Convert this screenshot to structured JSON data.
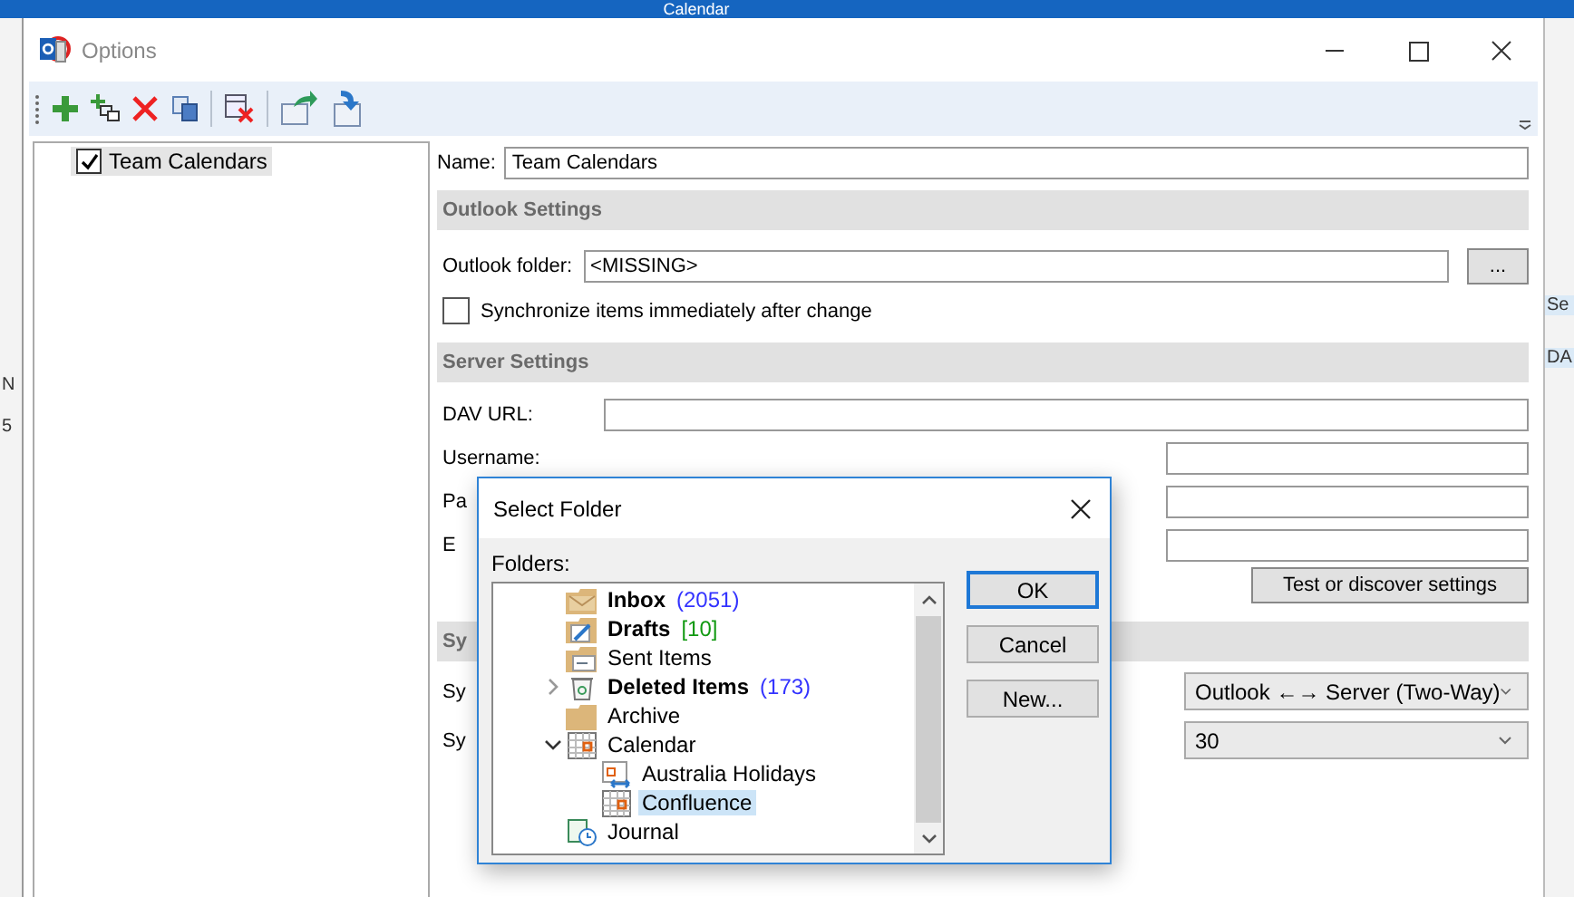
{
  "background": {
    "title": "Calendar",
    "left_fragments": [
      "N",
      "5"
    ],
    "right_fragments": [
      "Se",
      "DA"
    ]
  },
  "window": {
    "title": "Options"
  },
  "tree": [
    {
      "label": "Team Calendars",
      "checked": true,
      "selected": true
    }
  ],
  "form": {
    "name_label": "Name:",
    "name_value": "Team Calendars"
  },
  "outlook_settings": {
    "heading": "Outlook Settings",
    "folder_label": "Outlook folder:",
    "folder_value": "<MISSING>",
    "browse_button": "...",
    "sync_immediately": {
      "label": "Synchronize items immediately after change",
      "checked": false
    }
  },
  "server_settings": {
    "heading": "Server Settings",
    "fields": [
      {
        "label": "DAV URL:",
        "kind": "wide"
      },
      {
        "label": "Username:",
        "kind": "short"
      },
      {
        "label": "Pa",
        "kind": "short"
      },
      {
        "label": "E",
        "kind": "short"
      }
    ],
    "test_button": "Test or discover settings"
  },
  "sync_settings": {
    "heading": "Sy",
    "rows": [
      {
        "label": "Sy",
        "value": "Outlook ←→ Server (Two-Way)"
      },
      {
        "label": "Sy",
        "value": "30"
      }
    ]
  },
  "dialog": {
    "title": "Select Folder",
    "folders_label": "Folders:",
    "folders": [
      {
        "label": "Inbox",
        "kind": "mail",
        "bold": true,
        "count": "(2051)",
        "color": "#3333ff",
        "selected": false
      },
      {
        "label": "Drafts",
        "kind": "drafts",
        "bold": true,
        "count": "[10]",
        "color": "#119911",
        "selected": false
      },
      {
        "label": "Sent Items",
        "kind": "sent",
        "bold": false,
        "selected": false
      },
      {
        "label": "Deleted Items",
        "kind": "trash",
        "bold": true,
        "count": "(173)",
        "color": "#3333ff",
        "expanded": false,
        "selected": false
      },
      {
        "label": "Archive",
        "kind": "folder",
        "bold": false,
        "selected": false
      },
      {
        "label": "Calendar",
        "kind": "calendar",
        "bold": false,
        "expanded": true,
        "selected": false,
        "children": [
          {
            "label": "Australia Holidays",
            "kind": "shared-calendar",
            "bold": false,
            "selected": false
          },
          {
            "label": "Confluence",
            "kind": "calendar",
            "bold": false,
            "selected": true
          }
        ]
      },
      {
        "label": "Journal",
        "kind": "journal",
        "bold": false,
        "selected": false
      }
    ],
    "buttons": [
      {
        "label": "OK",
        "default": true
      },
      {
        "label": "Cancel",
        "default": false
      },
      {
        "label": "New...",
        "default": false
      }
    ]
  }
}
